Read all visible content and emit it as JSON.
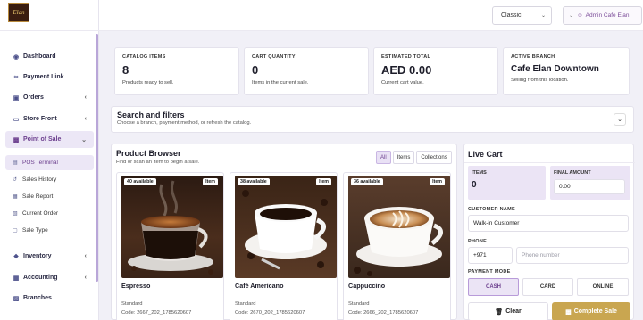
{
  "brand": {
    "logo_text": "Elan"
  },
  "topbar": {
    "theme_select": "Classic",
    "user_label": "Admin Cafe Elan"
  },
  "sidebar": {
    "items": [
      {
        "label": "Dashboard",
        "icon": "palette-icon"
      },
      {
        "label": "Payment Link",
        "icon": "link-icon"
      },
      {
        "label": "Orders",
        "icon": "cart-icon"
      },
      {
        "label": "Store Front",
        "icon": "monitor-icon"
      },
      {
        "label": "Point of Sale",
        "icon": "store-icon"
      },
      {
        "label": "Inventory",
        "icon": "boxes-icon"
      },
      {
        "label": "Accounting",
        "icon": "calculator-icon"
      },
      {
        "label": "Branches",
        "icon": "building-icon"
      }
    ],
    "pos_sub": [
      {
        "label": "POS Terminal",
        "icon": "terminal-icon"
      },
      {
        "label": "Sales History",
        "icon": "history-icon"
      },
      {
        "label": "Sale Report",
        "icon": "report-icon"
      },
      {
        "label": "Current Order",
        "icon": "chart-icon"
      },
      {
        "label": "Sale Type",
        "icon": "file-icon"
      }
    ]
  },
  "stats": {
    "catalog": {
      "label": "CATALOG ITEMS",
      "value": "8",
      "sub": "Products ready to sell."
    },
    "cart_qty": {
      "label": "CART QUANTITY",
      "value": "0",
      "sub": "Items in the current sale."
    },
    "total": {
      "label": "ESTIMATED TOTAL",
      "value": "AED 0.00",
      "sub": "Current cart value."
    },
    "branch": {
      "label": "ACTIVE BRANCH",
      "value": "Cafe Elan Downtown",
      "sub": "Selling from this location."
    }
  },
  "filters": {
    "title": "Search and filters",
    "subtitle": "Choose a branch, payment method, or refresh the catalog."
  },
  "browser": {
    "title": "Product Browser",
    "subtitle": "Find or scan an item to begin a sale.",
    "tabs": [
      "All",
      "Items",
      "Collections"
    ],
    "products": [
      {
        "name": "Espresso",
        "available": "40 available",
        "type": "Item",
        "variant": "Standard",
        "code": "Code: 2667_202_1785620607"
      },
      {
        "name": "Café Americano",
        "available": "38 available",
        "type": "Item",
        "variant": "Standard",
        "code": "Code: 2670_202_1785620607"
      },
      {
        "name": "Cappuccino",
        "available": "36 available",
        "type": "Item",
        "variant": "Standard",
        "code": "Code: 2666_202_1785620607"
      }
    ]
  },
  "cart": {
    "title": "Live Cart",
    "items_label": "ITEMS",
    "items_value": "0",
    "final_label": "FINAL AMOUNT",
    "final_value": "0.00",
    "customer_label": "CUSTOMER NAME",
    "customer_value": "Walk-in Customer",
    "phone_label": "PHONE",
    "phone_code": "+971",
    "phone_placeholder": "Phone number",
    "payment_label": "PAYMENT MODE",
    "payment_modes": [
      "CASH",
      "CARD",
      "ONLINE"
    ],
    "clear_label": "Clear",
    "complete_label": "Complete Sale"
  },
  "colors": {
    "accent": "#6c3f8e",
    "gold": "#c9a650",
    "soft": "#ebe4f5"
  }
}
